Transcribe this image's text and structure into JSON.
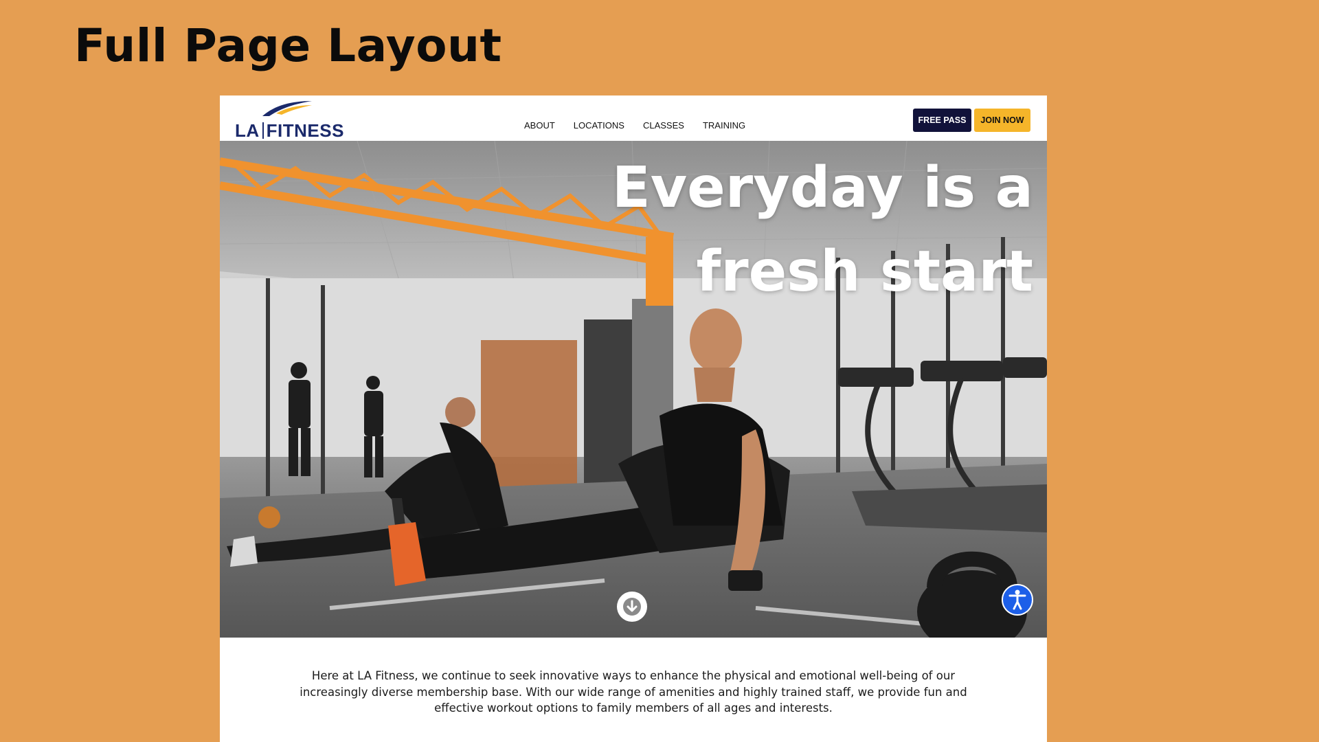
{
  "slide": {
    "title": "Full Page Layout"
  },
  "header": {
    "logo_text_left": "LA",
    "logo_text_right": "FITNESS",
    "nav": [
      "ABOUT",
      "LOCATIONS",
      "CLASSES",
      "TRAINING"
    ],
    "free_pass_label": "FREE PASS",
    "join_now_label": "JOIN NOW"
  },
  "hero": {
    "headline_line1": "Everyday is a",
    "headline_line2": "fresh start",
    "scroll_icon": "arrow-down-icon",
    "accessibility_icon": "accessibility-icon"
  },
  "intro": {
    "text": "Here at LA Fitness, we continue to seek innovative ways to enhance the physical and emotional well-being of our increasingly diverse membership base. With our wide range of amenities and highly trained staff, we provide fun and effective workout options to family members of all ages and interests."
  },
  "colors": {
    "slide_background": "#e59e52",
    "brand_navy": "#1b2a6b",
    "free_pass_bg": "#11123a",
    "join_now_bg": "#f5b52a",
    "accessibility_blue": "#1d5fe8",
    "hero_accent_orange": "#f0922e"
  }
}
